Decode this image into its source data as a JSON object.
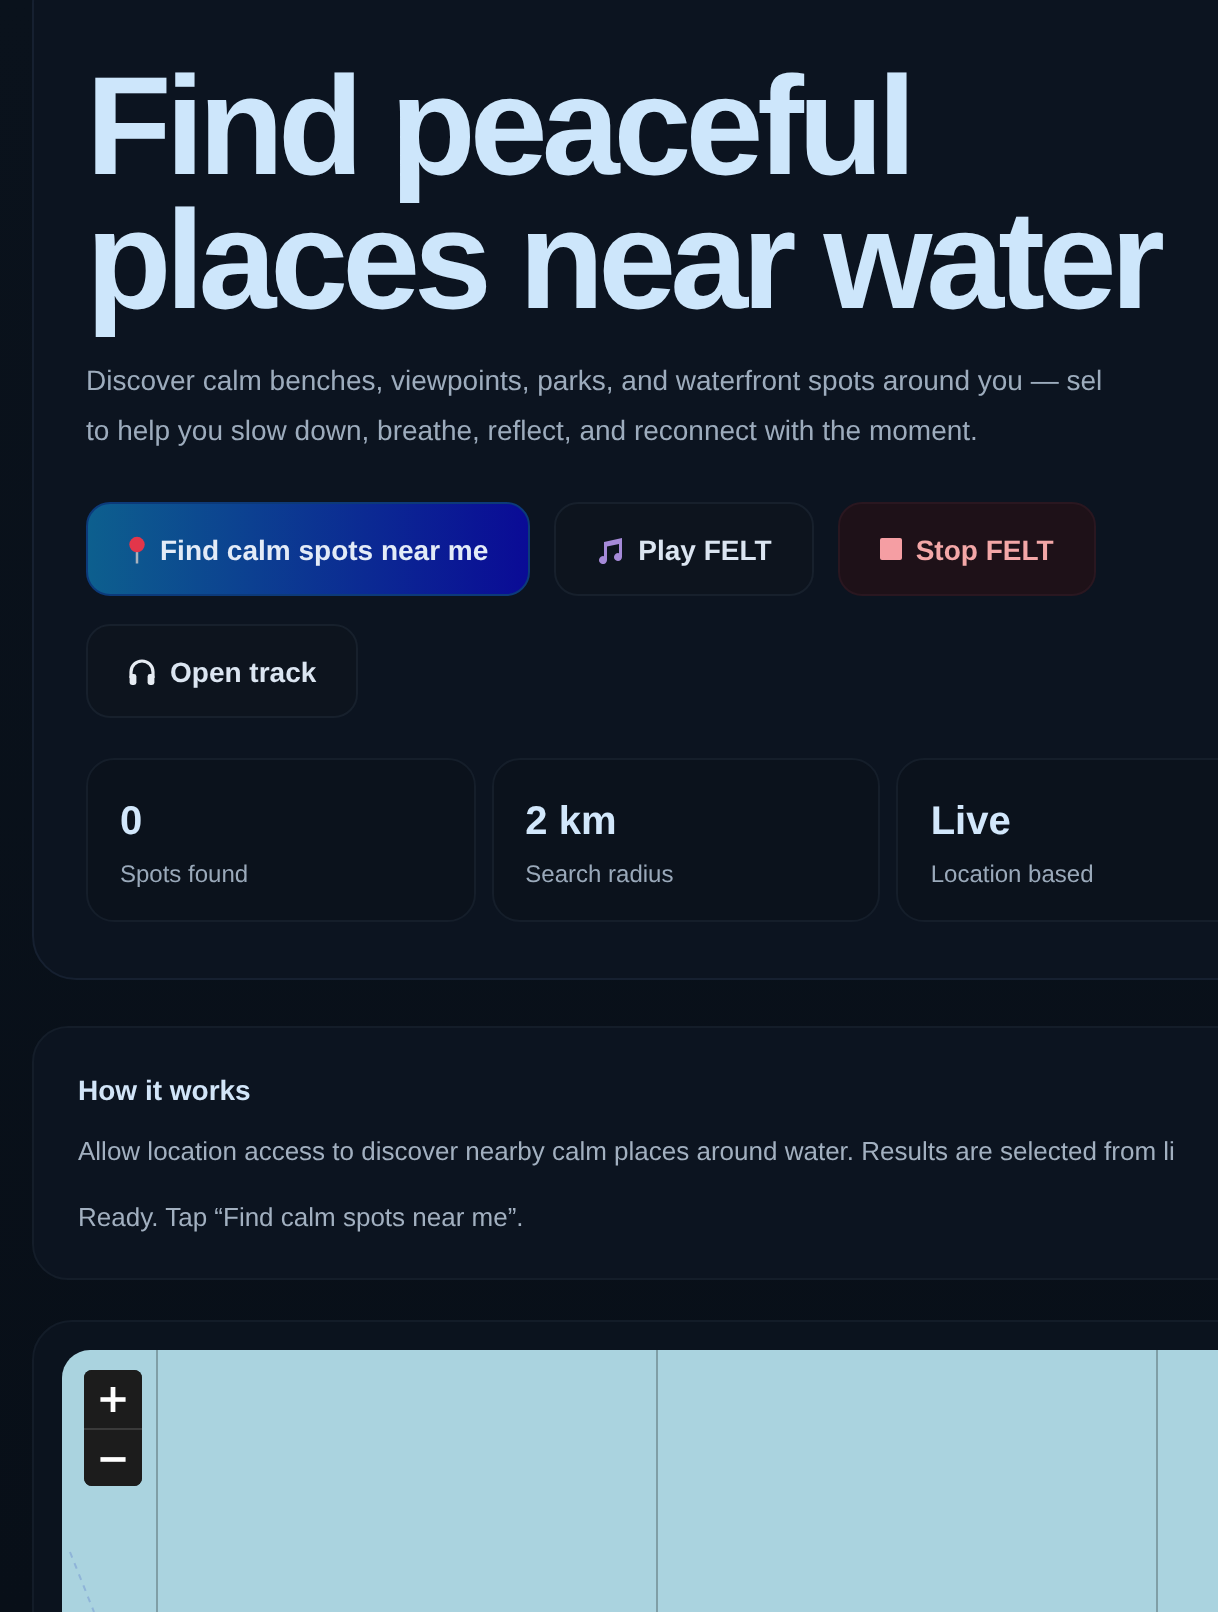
{
  "hero": {
    "title": "Find peaceful places near water",
    "description_lines": [
      "Discover calm benches, viewpoints, parks, and waterfront spots around you — sel",
      "to help you slow down, breathe, reflect, and reconnect with the moment."
    ],
    "buttons": [
      {
        "label": "Find calm spots near me",
        "kind": "primary"
      },
      {
        "label": "Play FELT",
        "kind": "secondary"
      },
      {
        "label": "Stop FELT",
        "kind": "danger"
      },
      {
        "label": "Open track",
        "kind": "secondary"
      }
    ],
    "stats": [
      {
        "value": "0",
        "label": "Spots found"
      },
      {
        "value": "2 km",
        "label": "Search radius"
      },
      {
        "value": "Live",
        "label": "Location based"
      }
    ]
  },
  "info": {
    "title": "How it works",
    "text": "Allow location access to discover nearby calm places around water. Results are selected from li",
    "status": "Ready. Tap “Find calm spots near me”."
  },
  "map": {
    "zoom_controls": [
      "+",
      "−"
    ]
  }
}
